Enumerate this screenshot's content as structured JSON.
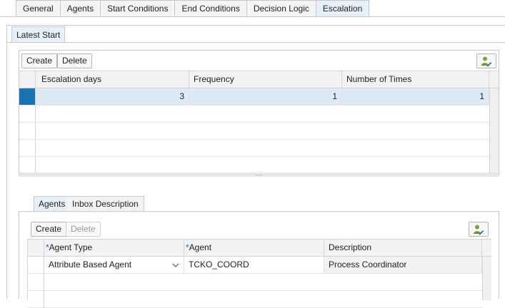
{
  "top_tabs": [
    "General",
    "Agents",
    "Start Conditions",
    "End Conditions",
    "Decision Logic",
    "Escalation"
  ],
  "active_top_tab": "Escalation",
  "sub_tab": "Latest Start",
  "escalation_table": {
    "toolbar": {
      "create": "Create",
      "delete": "Delete"
    },
    "columns": [
      "Escalation days",
      "Frequency",
      "Number of Times"
    ],
    "rows": [
      {
        "escalation_days": "3",
        "frequency": "1",
        "number_of_times": "1",
        "selected": true
      }
    ],
    "splitter": "...."
  },
  "lower_tabs": [
    "Agents",
    "Inbox Description"
  ],
  "active_lower_tab": "Agents",
  "agents_table": {
    "toolbar": {
      "create": "Create",
      "delete": "Delete"
    },
    "required_marker": "*",
    "columns": [
      "Agent Type",
      "Agent",
      "Description"
    ],
    "rows": [
      {
        "agent_type": "Attribute Based Agent",
        "agent": "TCKO_COORD",
        "description": "Process Coordinator"
      }
    ]
  },
  "icons": {
    "settings": "personalize-icon"
  },
  "colors": {
    "selected_row_marker": "#1873b4",
    "selected_row_bg": "#dde9f4",
    "active_tab_bg": "#e7f0f8"
  }
}
